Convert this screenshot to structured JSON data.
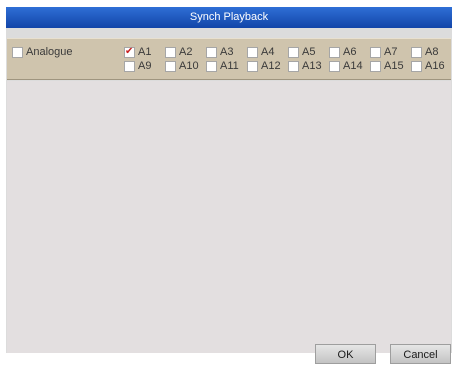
{
  "dialog": {
    "title": "Synch Playback"
  },
  "group": {
    "label": "Analogue",
    "checked": false
  },
  "channels": [
    {
      "label": "A1",
      "checked": true
    },
    {
      "label": "A2",
      "checked": false
    },
    {
      "label": "A3",
      "checked": false
    },
    {
      "label": "A4",
      "checked": false
    },
    {
      "label": "A5",
      "checked": false
    },
    {
      "label": "A6",
      "checked": false
    },
    {
      "label": "A7",
      "checked": false
    },
    {
      "label": "A8",
      "checked": false
    },
    {
      "label": "A9",
      "checked": false
    },
    {
      "label": "A10",
      "checked": false
    },
    {
      "label": "A11",
      "checked": false
    },
    {
      "label": "A12",
      "checked": false
    },
    {
      "label": "A13",
      "checked": false
    },
    {
      "label": "A14",
      "checked": false
    },
    {
      "label": "A15",
      "checked": false
    },
    {
      "label": "A16",
      "checked": false
    }
  ],
  "buttons": {
    "ok": "OK",
    "cancel": "Cancel"
  }
}
